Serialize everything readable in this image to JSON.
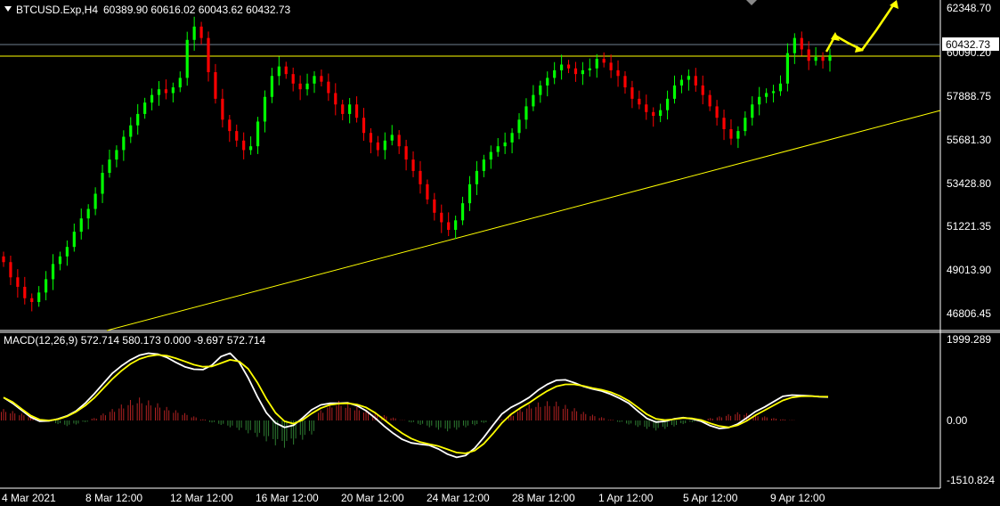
{
  "header": {
    "symbol": "BTCUSD.Exp,H4",
    "ohlc": "60389.90 60616.02 60043.62 60432.73"
  },
  "macd_panel": {
    "label": "MACD(12,26,9) 572.714 580.173 0.000 -9.697 572.714"
  },
  "price_axis": {
    "ticks": [
      "62348.70",
      "60090.20",
      "57888.75",
      "55681.30",
      "53428.80",
      "51221.35",
      "49013.90",
      "46806.45"
    ],
    "current_price": "60432.73"
  },
  "macd_axis": {
    "ticks": [
      "1999.289",
      "0.00",
      "-1510.824"
    ]
  },
  "time_axis": {
    "labels": [
      "4 Mar 2021",
      "8 Mar 12:00",
      "12 Mar 12:00",
      "16 Mar 12:00",
      "20 Mar 12:00",
      "24 Mar 12:00",
      "28 Mar 12:00",
      "1 Apr 12:00",
      "5 Apr 12:00",
      "9 Apr 12:00"
    ]
  },
  "colors": {
    "background": "#000000",
    "bull": "#00ff00",
    "bear": "#ff0000",
    "hist_pos": "#b22222",
    "hist_neg": "#2e7d32",
    "macd_line": "#ffffff",
    "signal_line": "#ffff00",
    "trendline": "#ffff00",
    "arrow": "#ffff00",
    "axis_line": "#ffffff"
  },
  "chart_data": [
    {
      "type": "candlestick",
      "ylim": [
        45900,
        63300
      ],
      "series": [
        {
          "values": [
            49500,
            48700,
            48200,
            47600,
            47400,
            47900,
            48600,
            49400,
            49800,
            50300,
            51100,
            51800,
            52300,
            53100,
            54200,
            54900,
            55400,
            56100,
            56700,
            57300,
            57900,
            58300,
            58600,
            58400,
            58700,
            59200,
            61200,
            61900,
            61300,
            59500,
            58100,
            57000,
            56400,
            55900,
            55400,
            55600,
            56900,
            58200,
            59300,
            59800,
            59400,
            58900,
            58600,
            58900,
            59300,
            59000,
            58400,
            57800,
            57300,
            57800,
            57100,
            56300,
            55800,
            55400,
            55900,
            56200,
            55600,
            54900,
            54300,
            53600,
            52800,
            52100,
            51600,
            51200,
            51700,
            52600,
            53600,
            54300,
            54900,
            55300,
            55600,
            55800,
            56300,
            57000,
            57700,
            58300,
            58800,
            59200,
            59600,
            59900,
            59700,
            59400,
            59600,
            59700,
            60200,
            60000,
            59600,
            59300,
            58700,
            58100,
            57800,
            57400,
            57200,
            57500,
            58100,
            58800,
            59100,
            59300,
            58800,
            58300,
            57700,
            57100,
            56500,
            56000,
            56400,
            57100,
            57800,
            58200,
            58400,
            58500,
            58900,
            60500,
            61300,
            60700,
            60100,
            60300,
            60100,
            60400
          ]
        }
      ]
    },
    {
      "type": "line",
      "series": [
        {
          "values": [
            560,
            420,
            250,
            80,
            -20,
            -10,
            40,
            110,
            230,
            420,
            650,
            900,
            1150,
            1330,
            1480,
            1590,
            1640,
            1620,
            1540,
            1420,
            1310,
            1250,
            1240,
            1350,
            1560,
            1640,
            1420,
            1040,
            590,
            190,
            -60,
            -170,
            -120,
            60,
            260,
            380,
            420,
            420,
            430,
            360,
            240,
            60,
            -140,
            -320,
            -470,
            -560,
            -590,
            -620,
            -710,
            -840,
            -920,
            -870,
            -690,
            -420,
            -120,
            160,
            320,
            430,
            560,
            740,
            880,
            980,
            990,
            920,
            830,
            770,
            720,
            640,
            540,
            420,
            230,
            50,
            -40,
            -20,
            40,
            70,
            40,
            -20,
            -130,
            -200,
            -180,
            -90,
            60,
            220,
            330,
            460,
            590,
            620,
            610,
            600,
            580,
            572
          ]
        },
        {
          "values": [
            560,
            450,
            280,
            120,
            20,
            0,
            30,
            100,
            210,
            360,
            550,
            780,
            1010,
            1210,
            1380,
            1500,
            1570,
            1600,
            1580,
            1520,
            1440,
            1360,
            1310,
            1320,
            1400,
            1480,
            1440,
            1260,
            930,
            530,
            190,
            -20,
            -80,
            10,
            170,
            300,
            380,
            410,
            420,
            390,
            320,
            190,
            20,
            -160,
            -320,
            -450,
            -540,
            -590,
            -640,
            -720,
            -800,
            -820,
            -750,
            -580,
            -330,
            -60,
            150,
            300,
            430,
            580,
            720,
            830,
            880,
            880,
            840,
            790,
            750,
            690,
            600,
            480,
            320,
            150,
            40,
            10,
            30,
            60,
            50,
            10,
            -70,
            -140,
            -170,
            -120,
            -10,
            130,
            250,
            370,
            490,
            560,
            590,
            595,
            585,
            580
          ]
        },
        {
          "values": [
            280,
            230,
            170,
            110,
            40,
            -30,
            -90,
            -140,
            -100,
            -40,
            60,
            170,
            280,
            390,
            500,
            560,
            490,
            420,
            330,
            250,
            180,
            100,
            30,
            -50,
            -110,
            -170,
            -240,
            -320,
            -410,
            -520,
            -620,
            -680,
            -600,
            -480,
            -350,
            250,
            420,
            480,
            410,
            330,
            260,
            190,
            130,
            70,
            10,
            -50,
            -110,
            -170,
            -230,
            -270,
            -230,
            -170,
            -120,
            -60,
            -10,
            30,
            150,
            280,
            390,
            440,
            470,
            460,
            380,
            300,
            210,
            140,
            80,
            20,
            -40,
            -100,
            -160,
            -210,
            -250,
            -210,
            -150,
            -90,
            -40,
            10,
            60,
            100,
            150,
            200,
            180,
            140,
            100,
            60,
            30,
            10,
            0,
            0,
            0,
            0
          ]
        }
      ]
    }
  ]
}
